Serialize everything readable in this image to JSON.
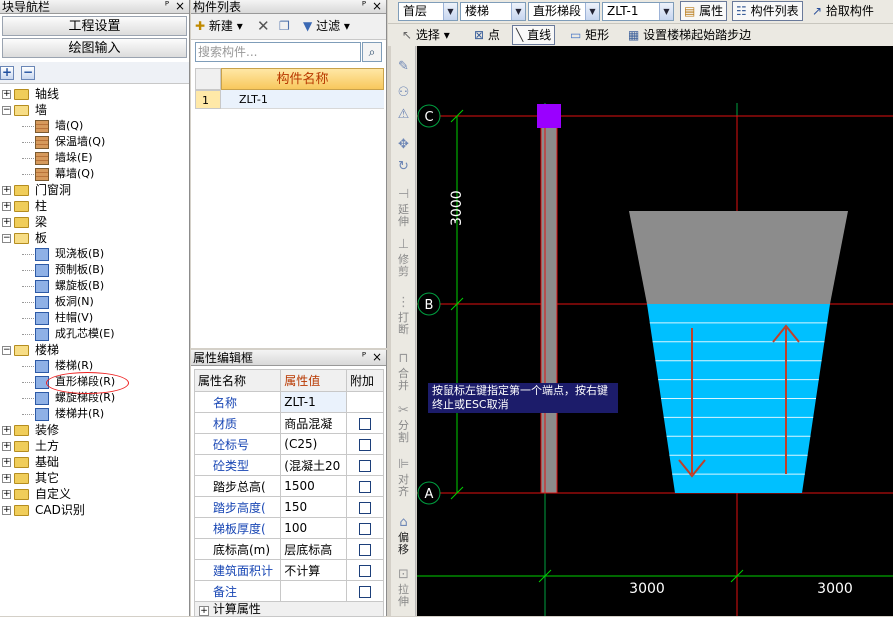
{
  "nav": {
    "title": "块导航栏",
    "btn_settings": "工程设置",
    "btn_drawing": "绘图输入",
    "tree": [
      {
        "label": "轴线",
        "level": 0,
        "type": "folder",
        "expanded": false
      },
      {
        "label": "墙",
        "level": 0,
        "type": "folder",
        "expanded": true
      },
      {
        "label": "墙(Q)",
        "level": 1,
        "type": "wall"
      },
      {
        "label": "保温墙(Q)",
        "level": 1,
        "type": "wall"
      },
      {
        "label": "墙垛(E)",
        "level": 1,
        "type": "wall"
      },
      {
        "label": "幕墙(Q)",
        "level": 1,
        "type": "wall"
      },
      {
        "label": "门窗洞",
        "level": 0,
        "type": "folder",
        "expanded": false
      },
      {
        "label": "柱",
        "level": 0,
        "type": "folder",
        "expanded": false
      },
      {
        "label": "梁",
        "level": 0,
        "type": "folder",
        "expanded": false
      },
      {
        "label": "板",
        "level": 0,
        "type": "folder",
        "expanded": true
      },
      {
        "label": "现浇板(B)",
        "level": 1,
        "type": "blue"
      },
      {
        "label": "预制板(B)",
        "level": 1,
        "type": "blue"
      },
      {
        "label": "螺旋板(B)",
        "level": 1,
        "type": "blue"
      },
      {
        "label": "板洞(N)",
        "level": 1,
        "type": "blue"
      },
      {
        "label": "柱帽(V)",
        "level": 1,
        "type": "blue"
      },
      {
        "label": "成孔芯模(E)",
        "level": 1,
        "type": "blue"
      },
      {
        "label": "楼梯",
        "level": 0,
        "type": "folder",
        "expanded": true
      },
      {
        "label": "楼梯(R)",
        "level": 1,
        "type": "blue"
      },
      {
        "label": "直形梯段(R)",
        "level": 1,
        "type": "blue"
      },
      {
        "label": "螺旋梯段(R)",
        "level": 1,
        "type": "blue"
      },
      {
        "label": "楼梯井(R)",
        "level": 1,
        "type": "blue"
      },
      {
        "label": "装修",
        "level": 0,
        "type": "folder",
        "expanded": false
      },
      {
        "label": "土方",
        "level": 0,
        "type": "folder",
        "expanded": false
      },
      {
        "label": "基础",
        "level": 0,
        "type": "folder",
        "expanded": false
      },
      {
        "label": "其它",
        "level": 0,
        "type": "folder",
        "expanded": false
      },
      {
        "label": "自定义",
        "level": 0,
        "type": "folder",
        "expanded": false
      },
      {
        "label": "CAD识别",
        "level": 0,
        "type": "folder",
        "expanded": false
      }
    ]
  },
  "list": {
    "title": "构件列表",
    "new_label": "新建",
    "filter_label": "过滤",
    "search_placeholder": "搜索构件...",
    "col_header": "构件名称",
    "rows": [
      {
        "num": "1",
        "name": "ZLT-1"
      }
    ]
  },
  "props": {
    "title": "属性编辑框",
    "headers": [
      "属性名称",
      "属性值",
      "附加"
    ],
    "rows": [
      {
        "name": "名称",
        "value": "ZLT-1",
        "check": false,
        "blue": true
      },
      {
        "name": "材质",
        "value": "商品混凝",
        "check": true,
        "blue": true
      },
      {
        "name": "砼标号",
        "value": "(C25)",
        "check": true,
        "blue": true
      },
      {
        "name": "砼类型",
        "value": "(混凝土20",
        "check": true,
        "blue": true
      },
      {
        "name": "踏步总高(",
        "value": "1500",
        "check": true,
        "blue": false
      },
      {
        "name": "踏步高度(",
        "value": "150",
        "check": true,
        "blue": true
      },
      {
        "name": "梯板厚度(",
        "value": "100",
        "check": true,
        "blue": true
      },
      {
        "name": "底标高(m)",
        "value": "层底标高",
        "check": true,
        "blue": false
      },
      {
        "name": "建筑面积计",
        "value": "不计算",
        "check": true,
        "blue": true
      },
      {
        "name": "备注",
        "value": "",
        "check": true,
        "blue": true
      }
    ],
    "footer": "计算属性"
  },
  "toolbar": {
    "floor": "首层",
    "category": "楼梯",
    "type": "直形梯段",
    "component": "ZLT-1",
    "btn_props": "属性",
    "btn_list": "构件列表",
    "btn_pick": "拾取构件",
    "btn_select": "选择",
    "btn_point": "点",
    "btn_line": "直线",
    "btn_rect": "矩形",
    "btn_setstart": "设置楼梯起始踏步边"
  },
  "vtool": [
    "延伸",
    "修剪",
    "打断",
    "合并",
    "分割",
    "对齐",
    "偏移",
    "拉伸"
  ],
  "canvas": {
    "axis_c": "C",
    "axis_b": "B",
    "axis_a": "A",
    "dim_vertical": "3000",
    "dim_bottom_1": "3000",
    "dim_bottom_2": "3000",
    "tooltip": "按鼠标左键指定第一个端点，按右键终止或ESC取消"
  },
  "colors": {
    "stair": "#00c0ff",
    "landing": "#909090",
    "axis_red": "#e01010",
    "axis_green": "#00a040",
    "dim": "#00d000",
    "marker": "#9a00ff"
  }
}
